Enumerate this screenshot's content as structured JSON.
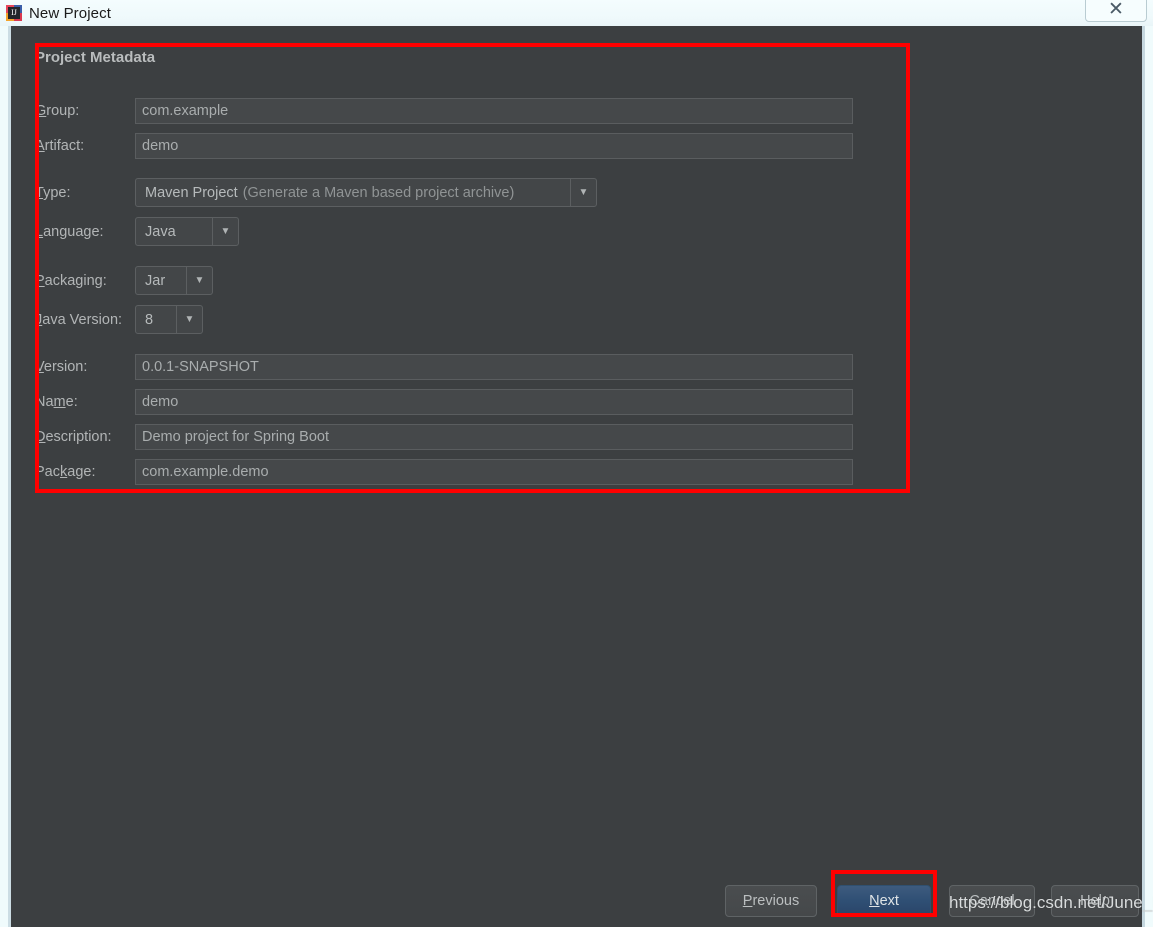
{
  "window": {
    "title": "New Project",
    "app_icon": "intellij-idea-icon",
    "close_label": "✕"
  },
  "form": {
    "section_title": "Project Metadata",
    "rows": [
      {
        "label": "Group:",
        "mnemonic": "G",
        "control": "text",
        "value": "com.example"
      },
      {
        "label": "Artifact:",
        "mnemonic": "A",
        "control": "text",
        "value": "demo"
      },
      {
        "label": "Type:",
        "mnemonic": "T",
        "control": "combo",
        "value": "Maven Project",
        "hint": "(Generate a Maven based project archive)"
      },
      {
        "label": "Language:",
        "mnemonic": "L",
        "control": "combo",
        "value": "Java"
      },
      {
        "label": "Packaging:",
        "mnemonic": "P",
        "control": "combo",
        "value": "Jar"
      },
      {
        "label": "Java Version:",
        "mnemonic": "J",
        "control": "combo",
        "value": "8"
      },
      {
        "label": "Version:",
        "mnemonic": "V",
        "control": "text",
        "value": "0.0.1-SNAPSHOT"
      },
      {
        "label": "Name:",
        "mnemonic": "m",
        "control": "text",
        "value": "demo"
      },
      {
        "label": "Description:",
        "mnemonic": "D",
        "control": "text",
        "value": "Demo project for Spring Boot"
      },
      {
        "label": "Package:",
        "mnemonic": "k",
        "control": "text",
        "value": "com.example.demo"
      }
    ],
    "labels": {
      "group": "Group:",
      "artifact": "Artifact:",
      "type": "Type:",
      "language": "Language:",
      "packaging": "Packaging:",
      "java_version": "Java Version:",
      "version": "Version:",
      "name": "Name:",
      "description": "Description:",
      "package": "Package:"
    },
    "values": {
      "group": "com.example",
      "artifact": "demo",
      "type": "Maven Project",
      "type_hint": "(Generate a Maven based project archive)",
      "language": "Java",
      "packaging": "Jar",
      "java_version": "8",
      "version": "0.0.1-SNAPSHOT",
      "name": "demo",
      "description": "Demo project for Spring Boot",
      "package": "com.example.demo"
    },
    "dropdown_arrow": "▼"
  },
  "buttons": {
    "previous": "Previous",
    "next": "Next",
    "cancel": "Cancel",
    "help": "Help"
  },
  "annotations": {
    "highlight_color": "#ff0000",
    "watermark": "https://blog.csdn.net/June_D"
  },
  "theme": {
    "dialog_background": "#3c3f41",
    "input_background": "#45484a",
    "text_color": "#b2b5b6",
    "accent_button": "#2f4f74",
    "titlebar_background": "#f2fcfd"
  }
}
